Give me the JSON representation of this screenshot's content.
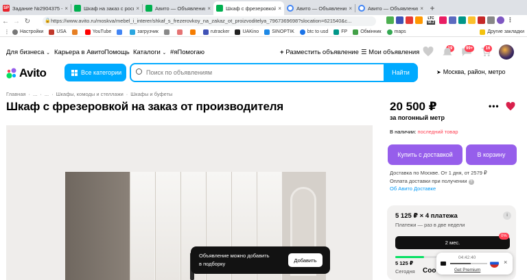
{
  "browser": {
    "tabs": [
      {
        "title": "Задание №2904375 - ...",
        "color": "#e8222b",
        "icon": "SP"
      },
      {
        "title": "Шкаф на заказ с роско...",
        "color": "#00b04f",
        "icon": ""
      },
      {
        "title": "Авито — Объявления н...",
        "color": "#00b04f",
        "icon": ""
      },
      {
        "title": "Шкаф с фрезеровкой на...",
        "color": "#00b04f",
        "icon": ""
      },
      {
        "title": "Авито — Объявления н...",
        "color": "#4285f4",
        "icon": ""
      },
      {
        "title": "Авито — Объявления н...",
        "color": "#4285f4",
        "icon": ""
      }
    ],
    "tab_close": "×",
    "new_tab": "+",
    "url": "https://www.avito.ru/moskva/mebel_i_interer/shkaf_s_frezerovkoy_na_zakaz_ot_proizvoditelya_7967369698?slocation=621540&c...",
    "bookmarks": [
      {
        "label": "Настройки",
        "color": "#777"
      },
      {
        "label": "USA",
        "color": "#c0392b"
      },
      {
        "label": "",
        "color": "#e67e22"
      },
      {
        "label": "YouTube",
        "color": "#ff0000"
      },
      {
        "label": "",
        "color": "#4285f4"
      },
      {
        "label": "загрузчик",
        "color": "#2aa6e0"
      },
      {
        "label": "",
        "color": "#888"
      },
      {
        "label": "",
        "color": "#e57373"
      },
      {
        "label": "",
        "color": "#f57c00"
      },
      {
        "label": "rutracker",
        "color": "#3f51b5"
      },
      {
        "label": "UAKino",
        "color": "#222"
      },
      {
        "label": "SINOPTIK",
        "color": "#1e88e5"
      },
      {
        "label": "btc to usd",
        "color": "#1a73e8"
      },
      {
        "label": "FP",
        "color": "#009688"
      },
      {
        "label": "Обмінник",
        "color": "#43a047"
      },
      {
        "label": "maps",
        "color": "#34a853"
      },
      {
        "label": "Другие закладки",
        "color": "#f4c20d"
      }
    ],
    "ext_ltc": "LTC",
    "ext_ltc_value": "58.2"
  },
  "avito": {
    "nav": {
      "for_business": "Для бизнеса",
      "career": "Карьера в Авито",
      "help": "Помощь",
      "catalogs": "Каталоги",
      "hashtag": "#яПомогаю",
      "post_ad": "Разместить объявление",
      "my_ads": "Мои объявления",
      "badge_favorites": "19",
      "badge_messages": "99+",
      "badge_cart": "16"
    },
    "logo": "Avito",
    "all_categories": "Все категории",
    "search_placeholder": "Поиск по объявлениям",
    "find_button": "Найти",
    "location": "Москва, район, метро",
    "breadcrumbs": [
      "Главная",
      "...",
      "...",
      "Шкафы, комоды и стеллажи",
      "Шкафы и буфеты"
    ],
    "breadcrumb_sep": "·",
    "title": "Шкаф с фрезеровкой на заказ от производителя",
    "price": "20 500 ₽",
    "price_unit": "за погонный метр",
    "availability_label": "В наличии:",
    "availability_value": "последний товар",
    "buy_with_delivery": "Купить с доставкой",
    "to_cart": "В корзину",
    "delivery_moscow": "Доставка по Москве. От 1 дня, от 2579 ₽",
    "delivery_payment": "Оплата доставки при получении",
    "avito_delivery": "Об Авито Доставке",
    "installment": {
      "title": "5 125 ₽ × 4 платежа",
      "subtitle": "Платежи — раз в две недели",
      "option": "2 мес.",
      "discount": "0%",
      "amount": "5 125 ₽",
      "today": "Сегодня",
      "progress": 0.25
    },
    "toast": {
      "text_line1": "Объявление можно добавить",
      "text_line2": "в подборку",
      "button": "Добавить"
    },
    "partial_text": "Соо"
  },
  "widget": {
    "time": "04:42:40",
    "link": "Get Premium",
    "close": "×"
  },
  "colors": {
    "accent": "#00aaff",
    "purple": "#965eeb",
    "link": "#0099f7",
    "red": "#ff4053",
    "heart": "#d8204b"
  }
}
